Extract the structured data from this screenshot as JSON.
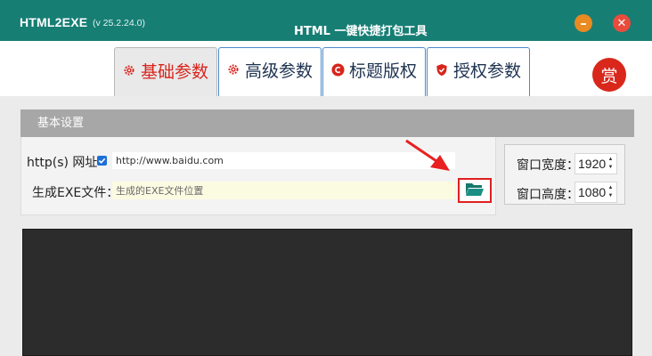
{
  "window": {
    "app_name": "HTML2EXE",
    "version": "(v 25.2.24.0)",
    "title": "HTML 一键快捷打包工具",
    "minimize_icon": "minimize-icon",
    "close_icon": "close-icon"
  },
  "tabs": [
    {
      "label": "基础参数",
      "icon": "gear-icon",
      "active": true
    },
    {
      "label": "高级参数",
      "icon": "gear-icon",
      "active": false
    },
    {
      "label": "标题版权",
      "icon": "copyright-icon",
      "active": false
    },
    {
      "label": "授权参数",
      "icon": "shield-check-icon",
      "active": false
    }
  ],
  "reward_button": "赏",
  "section": {
    "title": "基本设置"
  },
  "form": {
    "url_label": "http(s) 网址",
    "url_checked": true,
    "url_value": "http://www.baidu.com",
    "exe_label": "生成EXE文件：",
    "exe_placeholder": "生成的EXE文件位置",
    "browse_icon": "folder-open-icon"
  },
  "window_size": {
    "width_label": "窗口宽度：",
    "width_value": "1920",
    "height_label": "窗口高度：",
    "height_value": "1080"
  },
  "colors": {
    "titlebar": "#177e74",
    "accent_red": "#d8241c",
    "tab_border": "#4a8bc9",
    "folder_icon": "#17786f"
  }
}
